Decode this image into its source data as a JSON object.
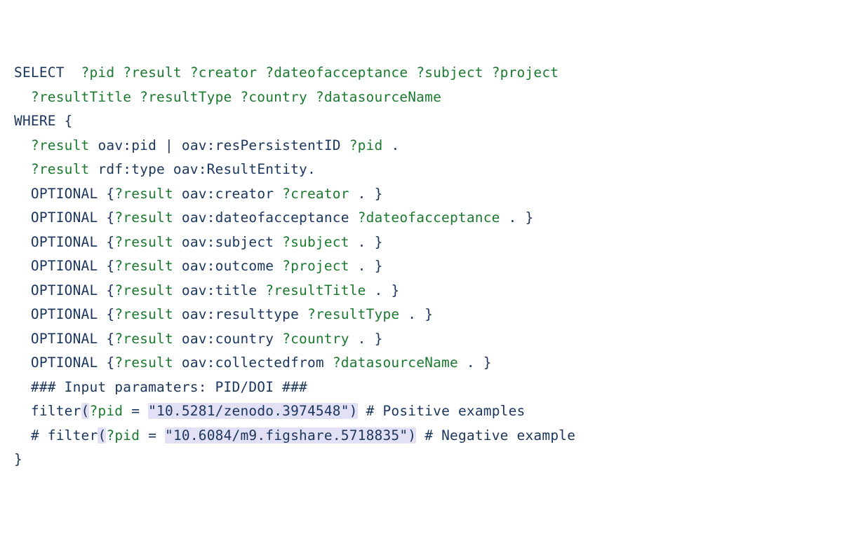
{
  "tok": {
    "SELECT": "SELECT",
    "WHERE": "WHERE",
    "LB": "{",
    "RB": "}",
    "OPTIONAL": "OPTIONAL",
    "DOT": ".",
    "PIPE": "|",
    "EQ": "=",
    "LP": "(",
    "RP": ")",
    "filter": "filter",
    "hash": "#",
    "hash3": "###"
  },
  "var": {
    "pid": "?pid",
    "result": "?result",
    "creator": "?creator",
    "dateofacceptance": "?dateofacceptance",
    "subject": "?subject",
    "project": "?project",
    "resultTitle": "?resultTitle",
    "resultType": "?resultType",
    "country": "?country",
    "datasourceName": "?datasourceName"
  },
  "pred": {
    "oav_pid": "oav:pid",
    "oav_resPersistentID": "oav:resPersistentID",
    "rdf_type": "rdf:type",
    "oav_ResultEntity": "oav:ResultEntity",
    "oav_creator": "oav:creator",
    "oav_dateofacceptance": "oav:dateofacceptance",
    "oav_subject": "oav:subject",
    "oav_outcome": "oav:outcome",
    "oav_title": "oav:title",
    "oav_resulttype": "oav:resulttype",
    "oav_country": "oav:country",
    "oav_collectedfrom": "oav:collectedfrom"
  },
  "comment": {
    "input_params": "Input paramaters: PID/DOI",
    "positive": "Positive examples",
    "negative": "Negative example"
  },
  "str": {
    "doi1": "\"10.5281/zenodo.3974548\"",
    "doi2": "\"10.6084/m9.figshare.5718835\""
  }
}
